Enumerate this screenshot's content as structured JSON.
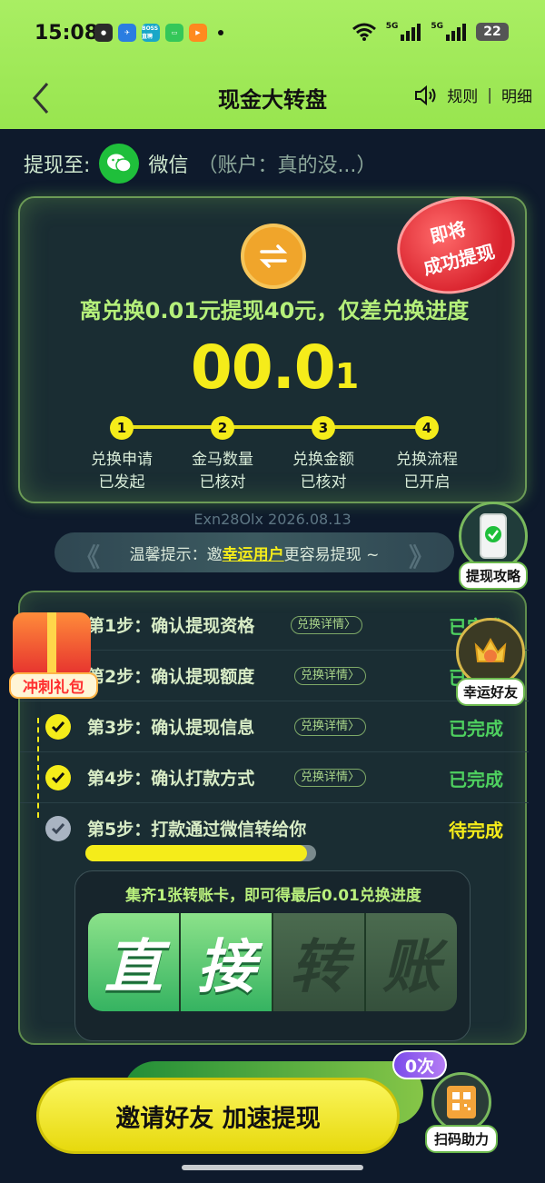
{
  "status_bar": {
    "time": "15:08",
    "battery": "22",
    "net1": "5G",
    "net2": "5G",
    "app_icon_boss": "BOSS直聘"
  },
  "nav": {
    "title": "现金大转盘",
    "rules": "规则",
    "separator": "|",
    "details": "明细"
  },
  "withdraw_to": {
    "label": "提现至:",
    "method": "微信",
    "account": "（账户：真的没...）"
  },
  "main_card": {
    "stamp_line1": "即将",
    "stamp_line2": "成功提现",
    "message": "离兑换0.01元提现40元，仅差兑换进度",
    "value_big": "00.0",
    "value_small": "1",
    "steps": [
      {
        "num": "1",
        "line1": "兑换申请",
        "line2": "已发起"
      },
      {
        "num": "2",
        "line1": "金马数量",
        "line2": "已核对"
      },
      {
        "num": "3",
        "line1": "兑换金额",
        "line2": "已核对"
      },
      {
        "num": "4",
        "line1": "兑换流程",
        "line2": "已开启"
      }
    ]
  },
  "serial": "Exn28Olx 2026.08.13",
  "tip": {
    "prefix": "温馨提示：邀",
    "highlight": "幸运用户",
    "suffix": "更容易提现 ~"
  },
  "badges": {
    "strategy": "提现攻略",
    "lucky_friend": "幸运好友",
    "gift": "冲刺礼包",
    "scan": "扫码助力"
  },
  "checklist": [
    {
      "text": "第1步：确认提现资格",
      "detail": "兑换详情〉",
      "status": "已完成",
      "done": true
    },
    {
      "text": "第2步：确认提现额度",
      "detail": "兑换详情〉",
      "status": "已完成",
      "done": true
    },
    {
      "text": "第3步：确认提现信息",
      "detail": "兑换详情〉",
      "status": "已完成",
      "done": true
    },
    {
      "text": "第4步：确认打款方式",
      "detail": "兑换详情〉",
      "status": "已完成",
      "done": true
    },
    {
      "text": "第5步：打款通过微信转给你",
      "detail": "",
      "status": "待完成",
      "done": false
    }
  ],
  "progress_fraction": 0.96,
  "ticker": "集齐1张转账卡，即可得最后0.01兑换进度",
  "transfer_tiles": [
    {
      "char": "直",
      "collected": true
    },
    {
      "char": "接",
      "collected": true
    },
    {
      "char": "转",
      "collected": false
    },
    {
      "char": "账",
      "collected": false
    }
  ],
  "invite": {
    "label": "邀请好友 加速提现",
    "count": "0次"
  },
  "colors": {
    "accent_yellow": "#f5ec1a",
    "header_green": "#a9ee63",
    "done_green": "#4ed05f",
    "bg": "#0e1a2c"
  }
}
